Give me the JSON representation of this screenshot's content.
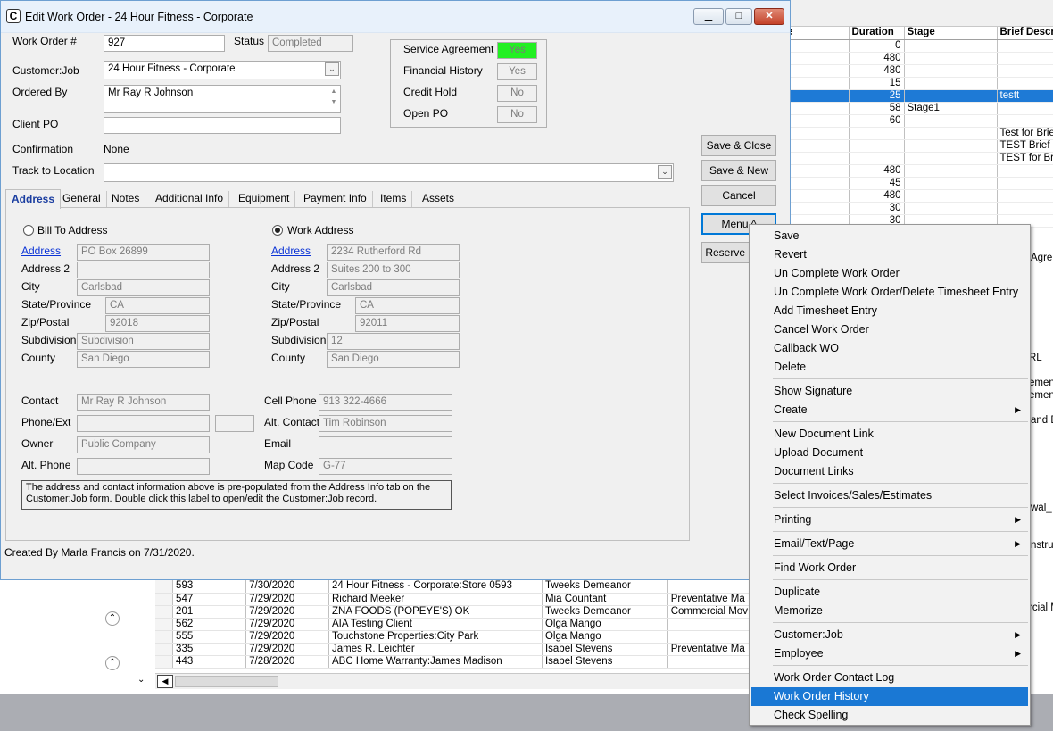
{
  "window": {
    "title": "Edit Work Order - 24 Hour Fitness - Corporate"
  },
  "header": {
    "work_order_label": "Work Order #",
    "work_order_value": "927",
    "status_label": "Status",
    "status_value": "Completed",
    "customer_label": "Customer:Job",
    "customer_value": "24 Hour Fitness - Corporate",
    "ordered_by_label": "Ordered By",
    "ordered_by_value": "Mr Ray R Johnson",
    "client_po_label": "Client PO",
    "client_po_value": "",
    "confirmation_label": "Confirmation",
    "confirmation_value": "None",
    "track_label": "Track to Location",
    "track_value": ""
  },
  "flags": [
    {
      "label": "Service Agreement",
      "value": "Yes",
      "color": "#22f022"
    },
    {
      "label": "Financial History",
      "value": "Yes"
    },
    {
      "label": "Credit Hold",
      "value": "No"
    },
    {
      "label": "Open PO",
      "value": "No"
    }
  ],
  "buttons": {
    "save_close": "Save & Close",
    "save_new": "Save & New",
    "cancel": "Cancel",
    "menu": "Menu ^",
    "reserve": "Reserve I"
  },
  "tabs": [
    "Address",
    "General",
    "Notes",
    "Additional Info",
    "Equipment",
    "Payment Info",
    "Items",
    "Assets"
  ],
  "address": {
    "bill_to_label": "Bill To Address",
    "work_label": "Work Address",
    "labels": {
      "address": "Address",
      "address2": "Address 2",
      "city": "City",
      "state": "State/Province",
      "zip": "Zip/Postal",
      "subdivision": "Subdivision",
      "county": "County"
    },
    "bill": {
      "address": "PO Box 26899",
      "address2": "",
      "city": "Carlsbad",
      "state": "CA",
      "zip": "92018",
      "subdivision": "Subdivision",
      "county": "San Diego"
    },
    "work": {
      "address": "2234 Rutherford Rd",
      "address2": "Suites 200 to 300",
      "city": "Carlsbad",
      "state": "CA",
      "zip": "92011",
      "subdivision": "12",
      "county": "San Diego"
    }
  },
  "contact": {
    "contact_label": "Contact",
    "contact_value": "Mr Ray R Johnson",
    "phone_label": "Phone/Ext",
    "phone_value": "",
    "ext_value": "",
    "owner_label": "Owner",
    "owner_value": "Public Company",
    "alt_phone_label": "Alt. Phone",
    "alt_phone_value": "",
    "cell_label": "Cell Phone",
    "cell_value": "913 322-4666",
    "alt_contact_label": "Alt. Contact",
    "alt_contact_value": "Tim Robinson",
    "email_label": "Email",
    "email_value": "",
    "map_label": "Map Code",
    "map_value": "G-77"
  },
  "note_text": "The address and contact information above is pre-populated from the Address Info tab on the Customer:Job form. Double click this label to open/edit the Customer:Job record.",
  "created_by": "Created By Marla Francis on 7/31/2020.",
  "menu": {
    "items": [
      {
        "label": "Save"
      },
      {
        "label": "Revert"
      },
      {
        "label": "Un Complete Work Order"
      },
      {
        "label": "Un Complete Work Order/Delete Timesheet Entry"
      },
      {
        "label": "Add Timesheet Entry"
      },
      {
        "label": "Cancel Work Order"
      },
      {
        "label": "Callback WO"
      },
      {
        "label": "Delete"
      },
      {
        "label": "Show Signature"
      },
      {
        "label": "Create",
        "submenu": true
      },
      {
        "label": "New Document Link"
      },
      {
        "label": "Upload Document"
      },
      {
        "label": "Document Links"
      },
      {
        "label": "Select Invoices/Sales/Estimates"
      },
      {
        "label": "Printing",
        "submenu": true
      },
      {
        "label": "Email/Text/Page",
        "submenu": true
      },
      {
        "label": "Find Work Order"
      },
      {
        "label": "Duplicate"
      },
      {
        "label": "Memorize"
      },
      {
        "label": "Customer:Job",
        "submenu": true
      },
      {
        "label": "Employee",
        "submenu": true
      },
      {
        "label": "Work Order Contact Log"
      },
      {
        "label": "Work Order History",
        "highlighted": true
      },
      {
        "label": "Check Spelling"
      }
    ]
  },
  "bg_grid": {
    "headers": [
      "e",
      "Duration",
      "Stage",
      "Brief Descr"
    ],
    "rows": [
      [
        "",
        "0",
        "",
        ""
      ],
      [
        "",
        "480",
        "",
        ""
      ],
      [
        "",
        "480",
        "",
        ""
      ],
      [
        "",
        "15",
        "",
        ""
      ],
      [
        "",
        "25",
        "",
        "testt"
      ],
      [
        "",
        "58",
        "Stage1",
        ""
      ],
      [
        "",
        "60",
        "",
        ""
      ],
      [
        "",
        "",
        "",
        "Test for Brief"
      ],
      [
        "",
        "",
        "",
        "TEST Brief De"
      ],
      [
        "",
        "",
        "",
        "TEST for Brie"
      ],
      [
        "",
        "480",
        "",
        ""
      ],
      [
        "",
        "45",
        "",
        ""
      ],
      [
        "",
        "480",
        "",
        ""
      ],
      [
        "",
        "30",
        "",
        ""
      ],
      [
        "",
        "30",
        "",
        ""
      ]
    ],
    "fragments": [
      "Agre",
      "RL",
      "ement",
      "ement",
      "and E",
      "wal_",
      "nstru",
      "rcial M"
    ]
  },
  "bg_list": {
    "rows": [
      [
        "593",
        "7/30/2020",
        "24 Hour Fitness - Corporate:Store 0593",
        "Tweeks Demeanor",
        ""
      ],
      [
        "547",
        "7/29/2020",
        "Richard Meeker",
        "Mia Countant",
        "Preventative Ma"
      ],
      [
        "201",
        "7/29/2020",
        "ZNA FOODS (POPEYE'S) OK",
        "Tweeks Demeanor",
        "Commercial Mov"
      ],
      [
        "562",
        "7/29/2020",
        "AIA Testing Client",
        "Olga Mango",
        ""
      ],
      [
        "555",
        "7/29/2020",
        "Touchstone Properties:City Park",
        "Olga Mango",
        ""
      ],
      [
        "335",
        "7/29/2020",
        "James R. Leichter",
        "Isabel Stevens",
        "Preventative Ma"
      ],
      [
        "443",
        "7/28/2020",
        "ABC Home Warranty:James Madison",
        "Isabel Stevens",
        ""
      ]
    ]
  }
}
